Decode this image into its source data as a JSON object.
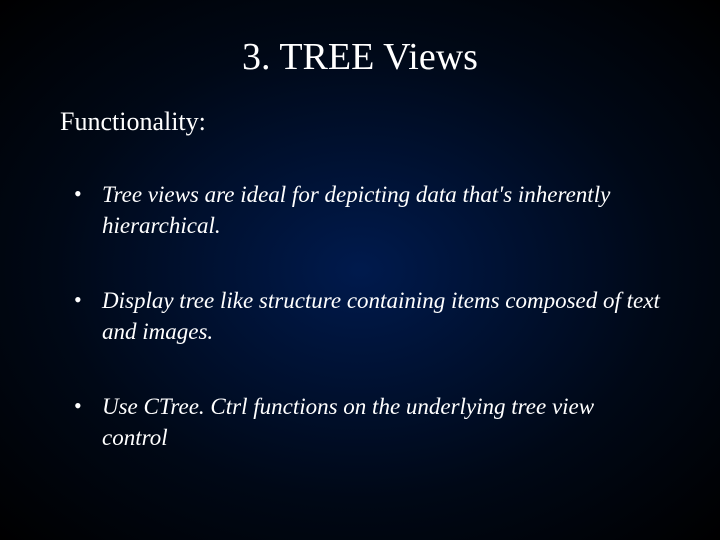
{
  "slide": {
    "title": "3. TREE Views",
    "subtitle": "Functionality:",
    "bullets": [
      "Tree views are ideal for depicting data that's inherently hierarchical.",
      "Display tree like structure containing items composed of text and images.",
      "Use CTree. Ctrl functions on the underlying tree view control"
    ]
  }
}
